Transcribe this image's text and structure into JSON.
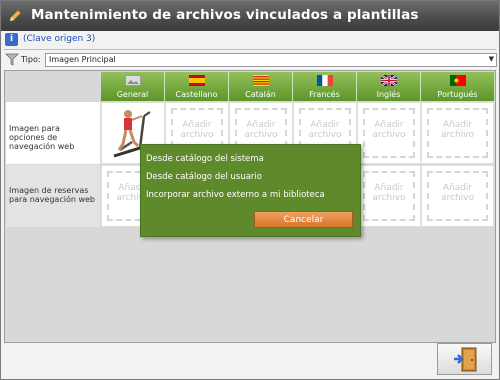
{
  "window": {
    "title": "Mantenimiento de archivos vinculados a plantillas"
  },
  "info": {
    "text": "(Clave origen 3)"
  },
  "type": {
    "label": "Tipo:",
    "selected": "Imagen Principal"
  },
  "languages": [
    {
      "label": "General",
      "icon": "generic-image-icon"
    },
    {
      "label": "Castellano",
      "icon": "spain-flag-icon"
    },
    {
      "label": "Catalán",
      "icon": "catalonia-flag-icon"
    },
    {
      "label": "Francés",
      "icon": "france-flag-icon"
    },
    {
      "label": "Inglés",
      "icon": "uk-flag-icon"
    },
    {
      "label": "Portugués",
      "icon": "portugal-flag-icon"
    }
  ],
  "rows": [
    {
      "label": "Imagen para opciones de navegación web"
    },
    {
      "label": "Imagen de reservas para navegación web"
    }
  ],
  "slot_text": "Añadir archivo",
  "popup": {
    "options": [
      "Desde catálogo del sistema",
      "Desde catálogo del usuario",
      "Incorporar archivo externo a mi biblioteca"
    ],
    "cancel_label": "Cancelar"
  },
  "colors": {
    "header_green": "#6fa536",
    "popup_green": "#5f8a2c",
    "cancel_orange": "#e07f35"
  }
}
